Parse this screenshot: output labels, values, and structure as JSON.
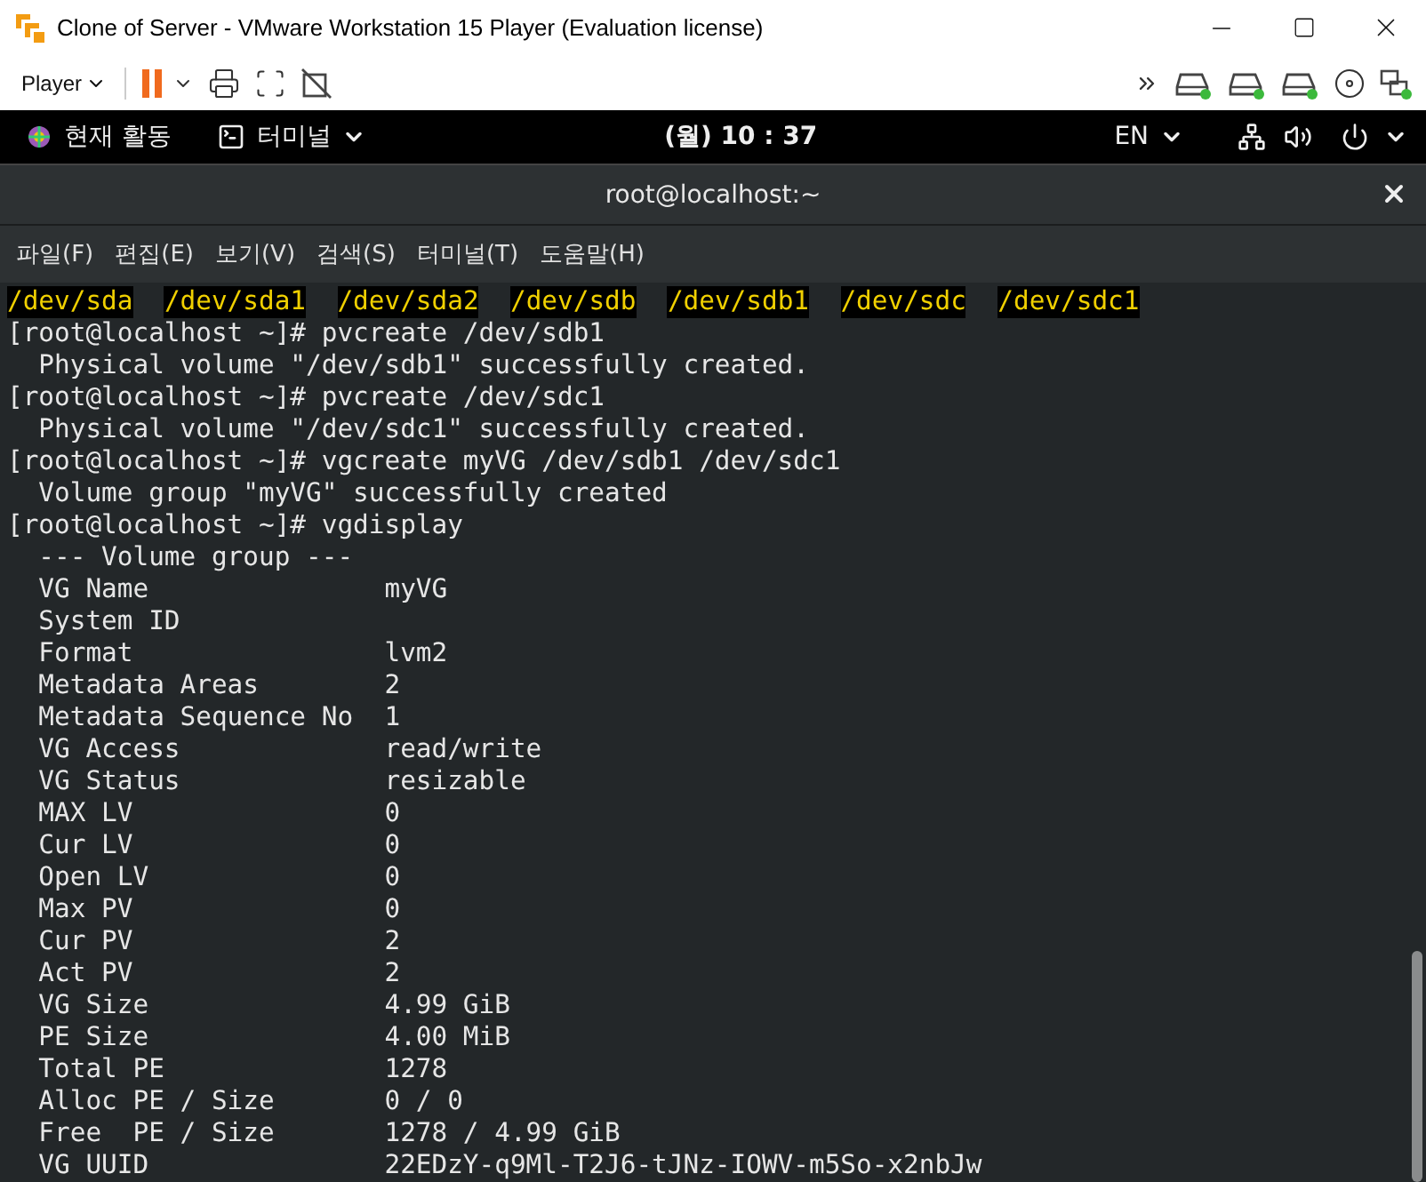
{
  "window": {
    "title": "Clone of Server - VMware Workstation 15 Player (Evaluation license)"
  },
  "toolbar": {
    "menu": "Player"
  },
  "top_bar": {
    "activities": "현재 활동",
    "app": "터미널",
    "clock": "(월) 10 : 37",
    "input_source": "EN"
  },
  "terminal": {
    "title": "root@localhost:~",
    "menu": [
      "파일(F)",
      "편집(E)",
      "보기(V)",
      "검색(S)",
      "터미널(T)",
      "도움말(H)"
    ],
    "devices": [
      "/dev/sda",
      "/dev/sda1",
      "/dev/sda2",
      "/dev/sdb",
      "/dev/sdb1",
      "/dev/sdc",
      "/dev/sdc1"
    ],
    "lines": [
      "[root@localhost ~]# pvcreate /dev/sdb1",
      "  Physical volume \"/dev/sdb1\" successfully created.",
      "[root@localhost ~]# pvcreate /dev/sdc1",
      "  Physical volume \"/dev/sdc1\" successfully created.",
      "[root@localhost ~]# vgcreate myVG /dev/sdb1 /dev/sdc1",
      "  Volume group \"myVG\" successfully created",
      "[root@localhost ~]# vgdisplay",
      "  --- Volume group ---",
      "  VG Name               myVG",
      "  System ID",
      "  Format                lvm2",
      "  Metadata Areas        2",
      "  Metadata Sequence No  1",
      "  VG Access             read/write",
      "  VG Status             resizable",
      "  MAX LV                0",
      "  Cur LV                0",
      "  Open LV               0",
      "  Max PV                0",
      "  Cur PV                2",
      "  Act PV                2",
      "  VG Size               4.99 GiB",
      "  PE Size               4.00 MiB",
      "  Total PE              1278",
      "  Alloc PE / Size       0 / 0",
      "  Free  PE / Size       1278 / 4.99 GiB",
      "  VG UUID               22EDzY-q9Ml-T2J6-tJNz-IOWV-m5So-x2nbJw"
    ]
  }
}
